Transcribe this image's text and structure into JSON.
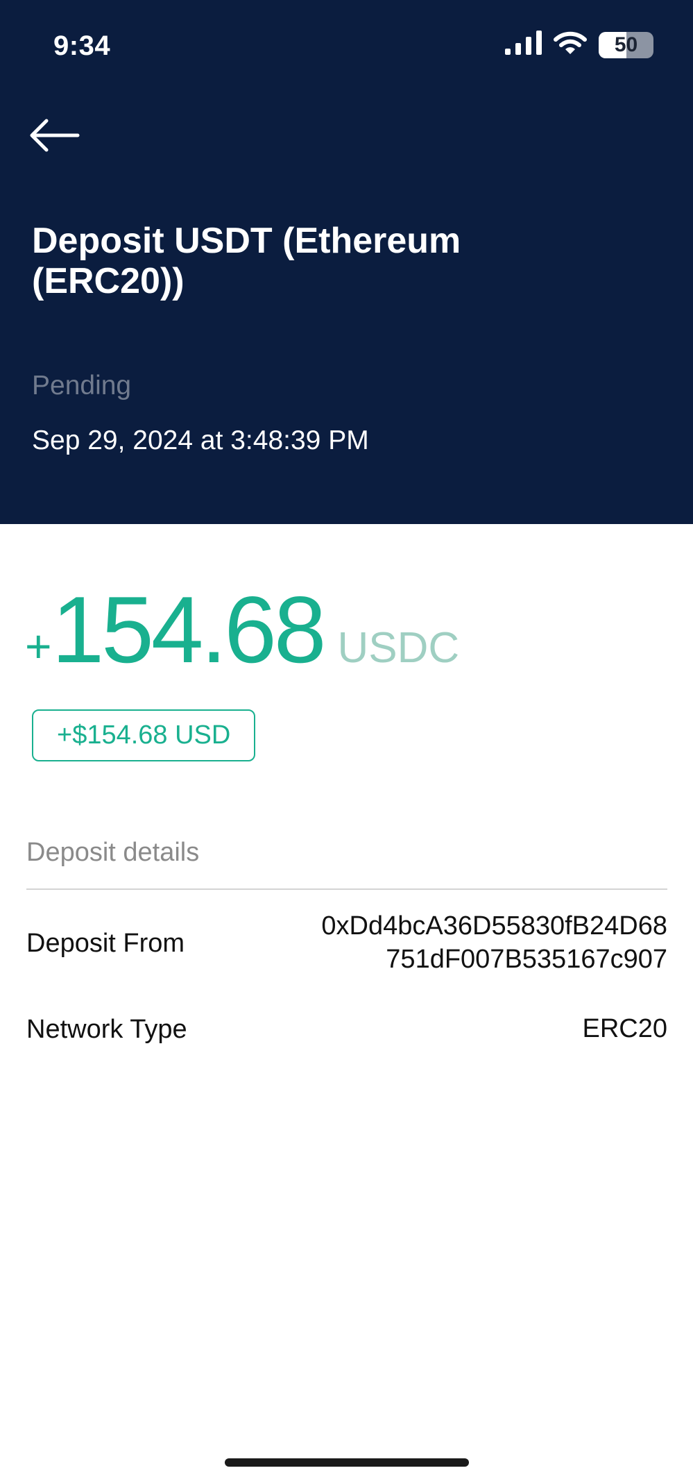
{
  "status_bar": {
    "time": "9:34",
    "battery_level": "50",
    "icons": [
      "cellular-signal-icon",
      "wifi-icon",
      "battery-icon"
    ]
  },
  "header": {
    "back_icon": "arrow-left-icon",
    "title": "Deposit USDT (Ethereum (ERC20))",
    "status": "Pending",
    "timestamp": "Sep 29, 2024 at 3:48:39 PM"
  },
  "amount": {
    "sign": "+",
    "value": "154.68",
    "currency": "USDC",
    "fiat_value": "+$154.68 USD"
  },
  "details": {
    "section_title": "Deposit details",
    "rows": [
      {
        "label": "Deposit From",
        "value_lines": [
          "0xDd4bcA36D55830fB24D68",
          "751dF007B535167c907"
        ]
      },
      {
        "label": "Network Type",
        "value_lines": [
          "ERC20"
        ]
      }
    ]
  },
  "colors": {
    "header_background": "#0b1d3f",
    "positive_amount": "#19b08f",
    "currency_muted": "#9fcfc2",
    "pending_status": "#717b8e"
  }
}
